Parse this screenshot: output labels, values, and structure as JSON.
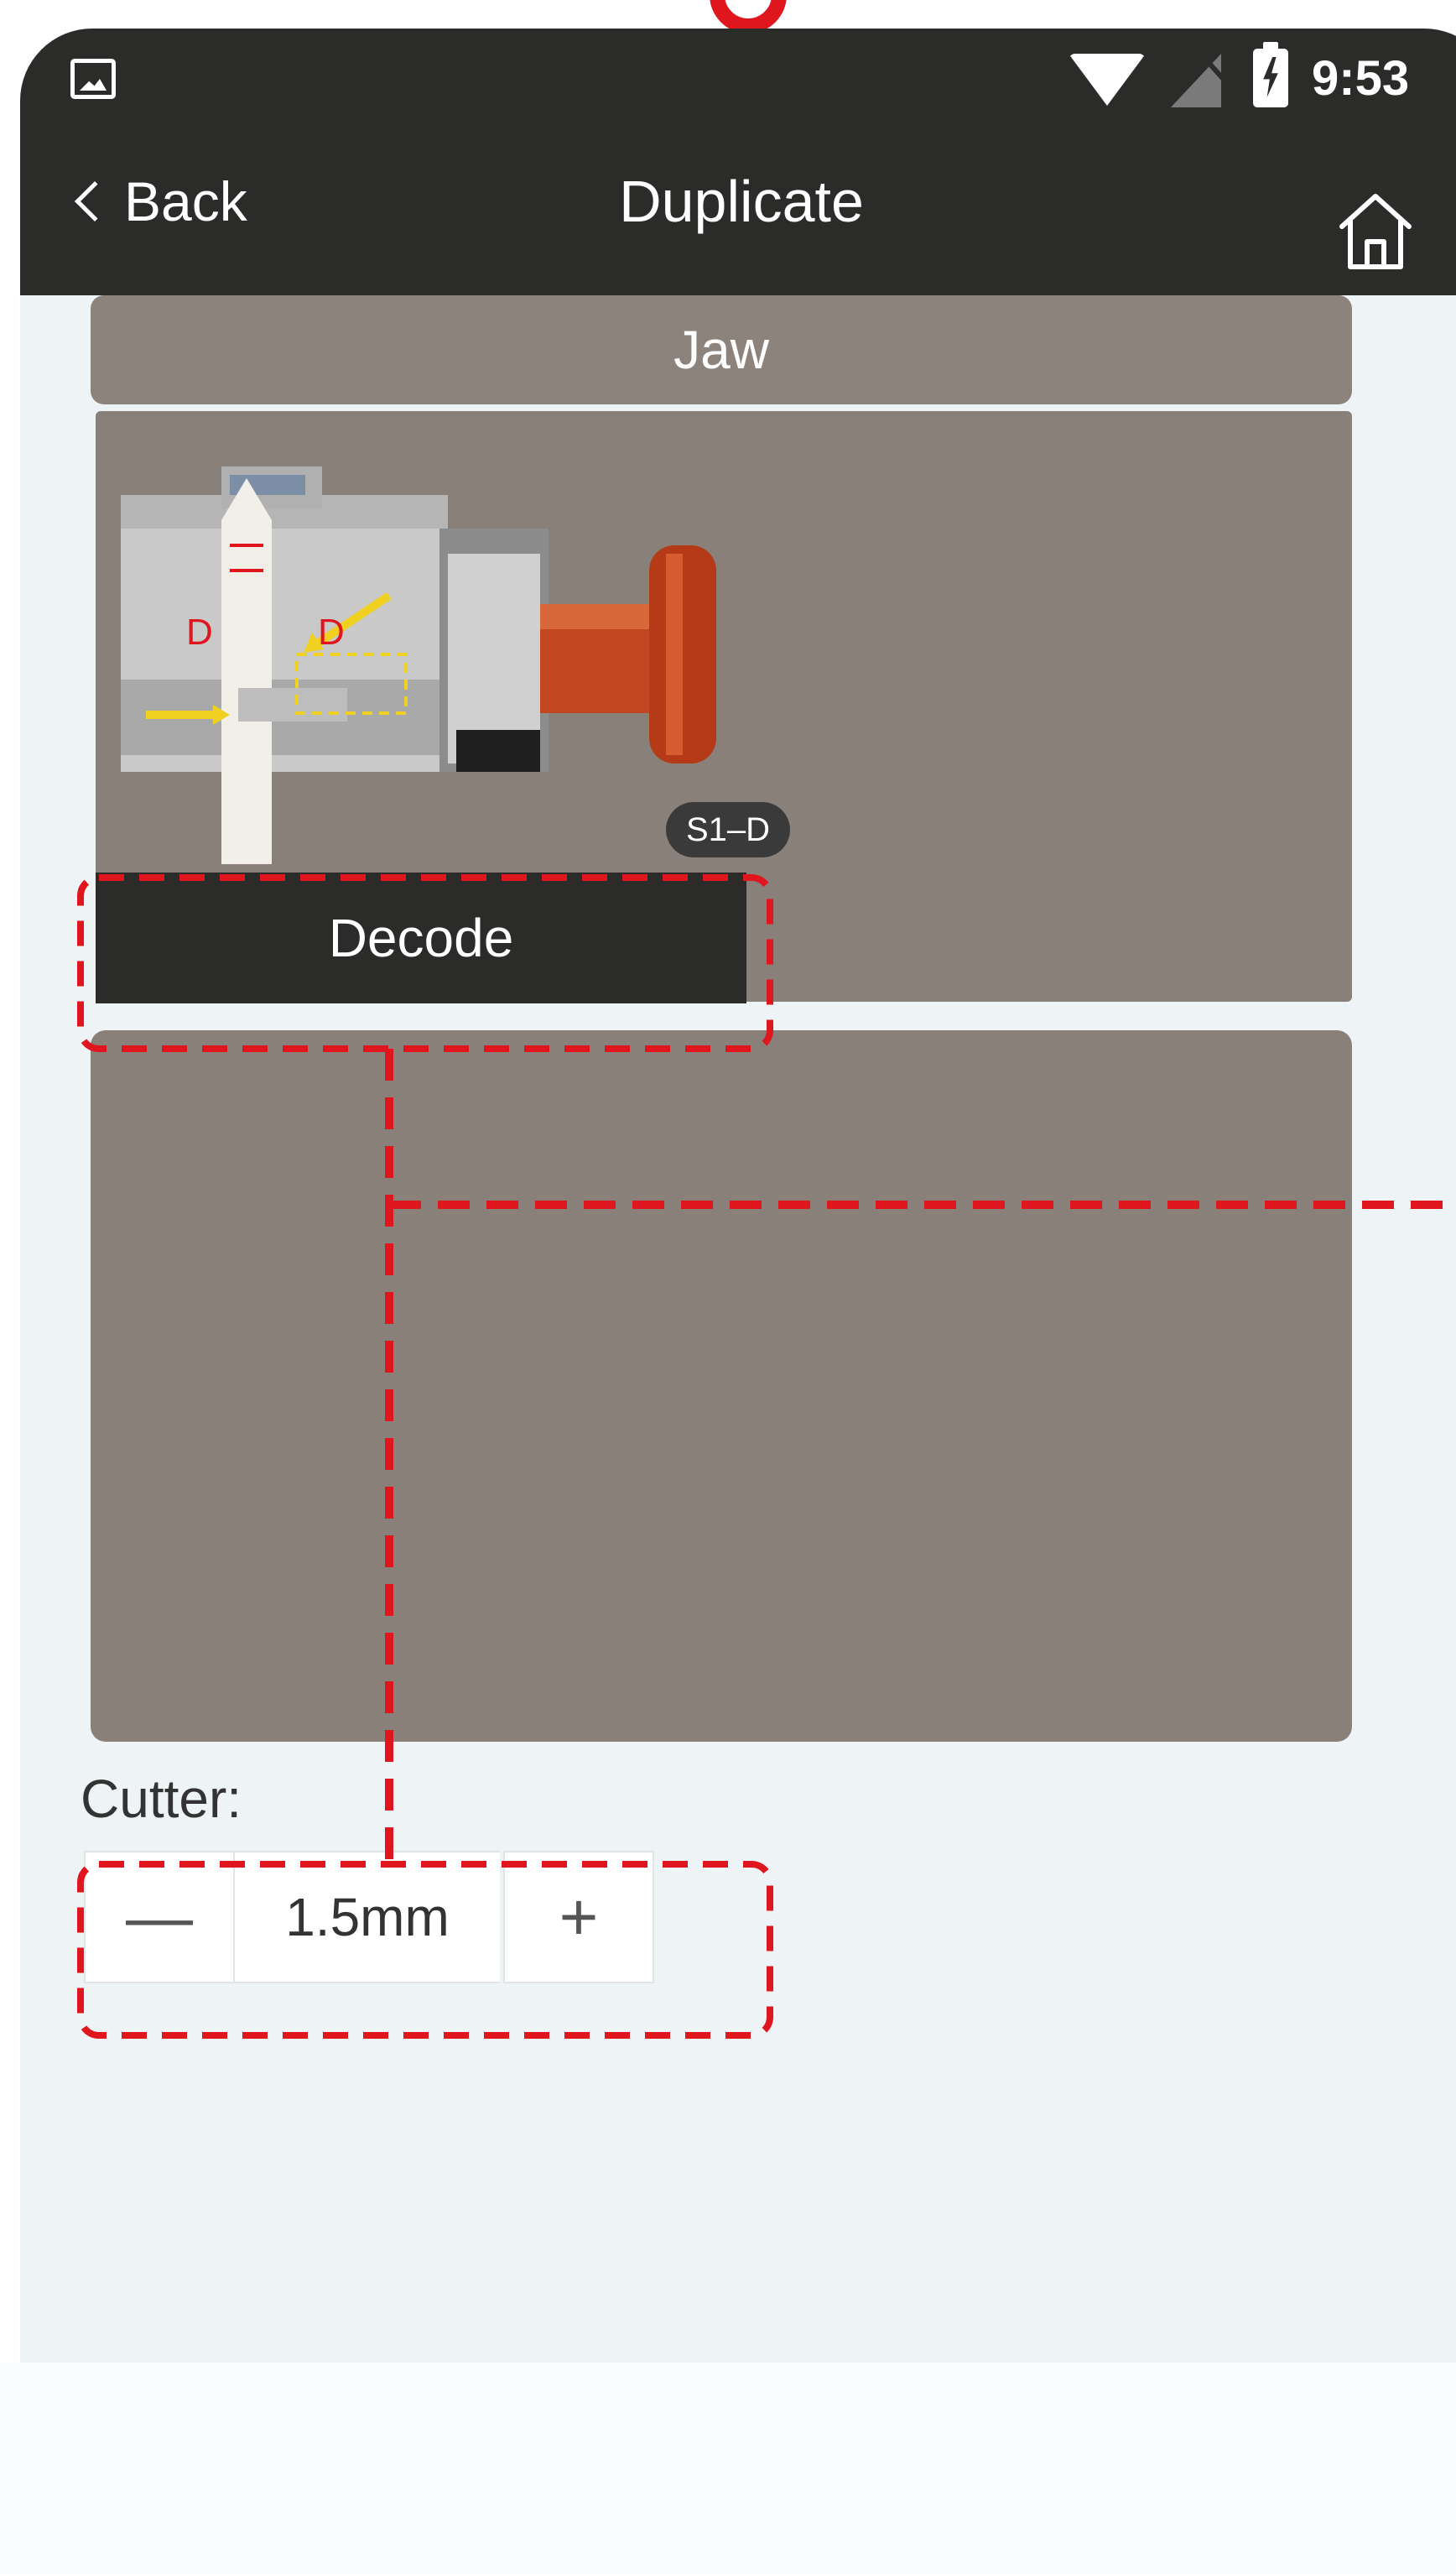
{
  "status_bar": {
    "time": "9:53"
  },
  "nav": {
    "back_label": "Back",
    "title": "Duplicate"
  },
  "jaw": {
    "header": "Jaw",
    "code": "S1–D",
    "marks": [
      "D",
      "D"
    ]
  },
  "decode": {
    "label": "Decode"
  },
  "cutter": {
    "label": "Cutter:",
    "value": "1.5mm",
    "minus": "—",
    "plus": "+"
  },
  "colors": {
    "bar": "#2b2b2a",
    "panel": "#8a807a",
    "background": "#eef3f5",
    "annotation": "#e0161f"
  }
}
